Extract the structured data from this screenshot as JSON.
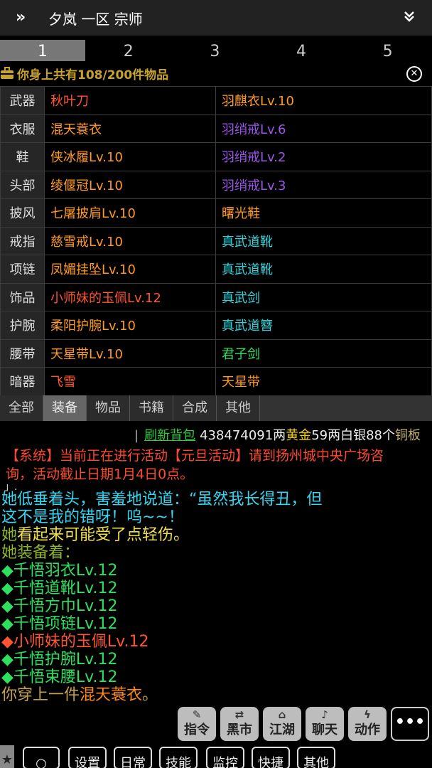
{
  "header": {
    "expand_icon": "»",
    "title": "夕岚 一区 宗师",
    "collapse_icon": "double-chevron-down"
  },
  "page_tabs": [
    "1",
    "2",
    "3",
    "4",
    "5"
  ],
  "inventory": {
    "label": "你身上共有108/200件物品"
  },
  "equipment": [
    {
      "slot": "武器",
      "left": "秋叶刀",
      "left_color": "#ff5530",
      "right": "羽麒衣Lv.10",
      "right_color": "#ff9a1f"
    },
    {
      "slot": "衣服",
      "left": "混天蓑衣",
      "left_color": "#ff9a1f",
      "right": "羽绡戒Lv.6",
      "right_color": "#9b55e8"
    },
    {
      "slot": "鞋",
      "left": "侠冰履Lv.10",
      "left_color": "#ff9a1f",
      "right": "羽绡戒Lv.2",
      "right_color": "#9b55e8"
    },
    {
      "slot": "头部",
      "left": "绫偃冠Lv.10",
      "left_color": "#ff9a1f",
      "right": "羽绡戒Lv.3",
      "right_color": "#9b55e8"
    },
    {
      "slot": "披风",
      "left": "七屠披肩Lv.10",
      "left_color": "#ff9a1f",
      "right": "曙光鞋",
      "right_color": "#ff9a1f"
    },
    {
      "slot": "戒指",
      "left": "慈雪戒Lv.10",
      "left_color": "#ff9a1f",
      "right": "真武道靴",
      "right_color": "#2ed6e0"
    },
    {
      "slot": "项链",
      "left": "凤媚挂坠Lv.10",
      "left_color": "#ff9a1f",
      "right": "真武道靴",
      "right_color": "#2ed6e0"
    },
    {
      "slot": "饰品",
      "left": "小师妹的玉佩Lv.12",
      "left_color": "#ff5530",
      "right": "真武剑",
      "right_color": "#2ed6e0"
    },
    {
      "slot": "护腕",
      "left": "柔阳护腕Lv.10",
      "left_color": "#ff9a1f",
      "right": "真武道簪",
      "right_color": "#2ed6e0"
    },
    {
      "slot": "腰带",
      "left": "天星带Lv.10",
      "left_color": "#ff9a1f",
      "right": "君子剑",
      "right_color": "#2ee060"
    },
    {
      "slot": "暗器",
      "left": "飞雪",
      "left_color": "#ff5530",
      "right": "天星带",
      "right_color": "#ff9a1f"
    }
  ],
  "category_tabs": [
    "全部",
    "装备",
    "物品",
    "书籍",
    "合成",
    "其他"
  ],
  "money": {
    "refresh": "刷新背包",
    "amount1": "438474091两",
    "gold": "黄金",
    "amount2": "59两白银88个",
    "copper": "铜板"
  },
  "log": {
    "system_line1": "【系统】当前正在进行活动【元旦活动】请到扬州城中央广场咨",
    "system_line2": "询，活动截止日期1月4日0点。",
    "dot": "」.",
    "speech1": "她低垂着头，害羞地说道：“虽然我长得丑，但",
    "speech2": "这不是我的错呀！呜~~！",
    "she": "她",
    "injured": "看起来可能受了点轻伤。",
    "equipped_header": "她装备着：",
    "equipped_items": [
      {
        "text": "◆千悟羽衣Lv.12",
        "color": "#2ee060"
      },
      {
        "text": "◆千悟道靴Lv.12",
        "color": "#2ee060"
      },
      {
        "text": "◆千悟方巾Lv.12",
        "color": "#2ee060"
      },
      {
        "text": "◆千悟项链Lv.12",
        "color": "#2ee060"
      },
      {
        "text": "◆小师妹的玉佩Lv.12",
        "color": "#ff5530"
      },
      {
        "text": "◆千悟护腕Lv.12",
        "color": "#2ee060"
      },
      {
        "text": "◆千悟束腰Lv.12",
        "color": "#2ee060"
      }
    ],
    "wear_prefix": "你穿上一件",
    "wear_item": "混天蓑衣",
    "wear_suffix": "。"
  },
  "commands": [
    {
      "label": "指令",
      "icon": "pencil-icon"
    },
    {
      "label": "黑市",
      "icon": "shuffle-icon"
    },
    {
      "label": "江湖",
      "icon": "home-icon"
    },
    {
      "label": "聊天",
      "icon": "speaker-icon"
    },
    {
      "label": "动作",
      "icon": "lightning-icon"
    }
  ],
  "more_label": "•••",
  "bottom_tabs": [
    "○",
    "设置",
    "日常",
    "技能",
    "监控",
    "快捷",
    "其他"
  ],
  "star": "★"
}
